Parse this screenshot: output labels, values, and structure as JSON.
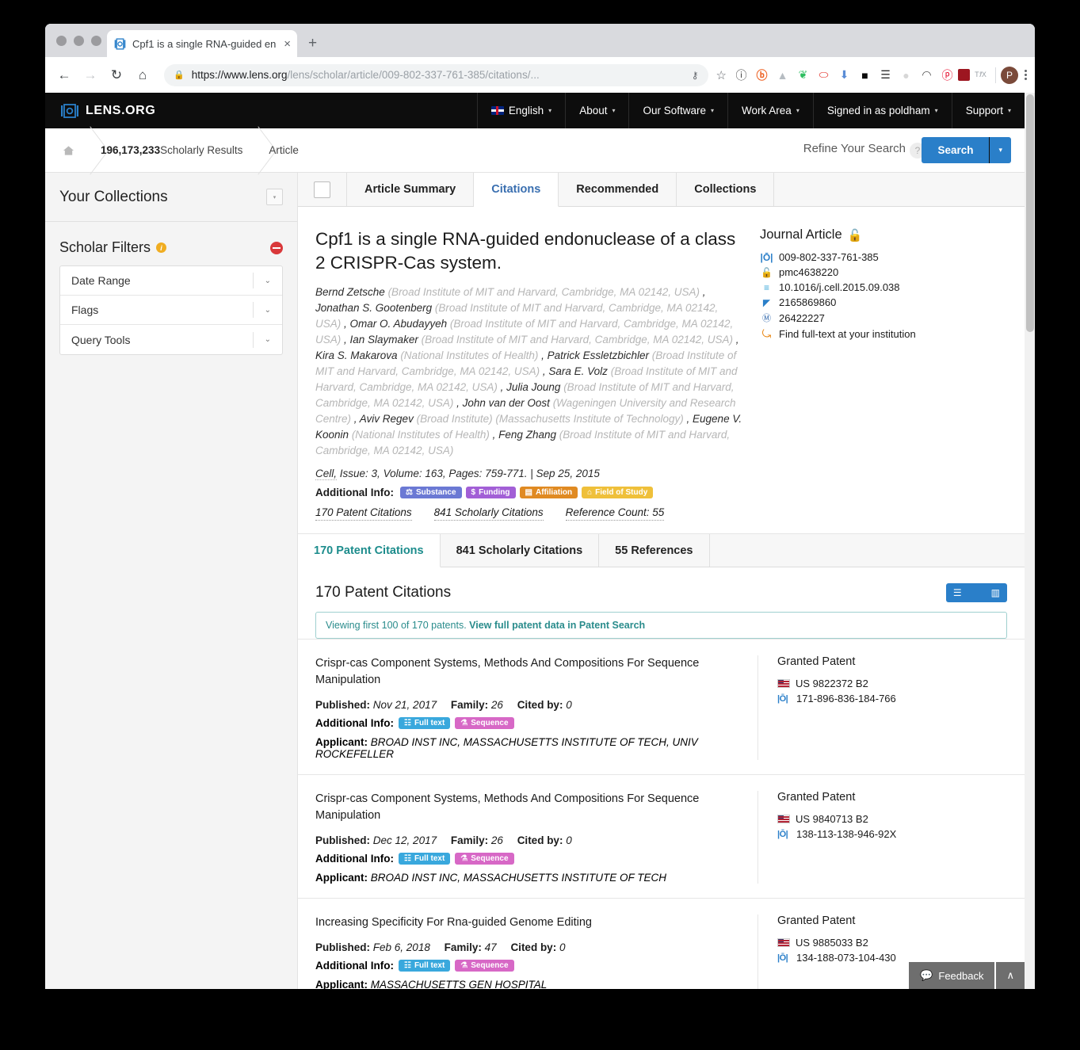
{
  "browser": {
    "tab": {
      "title": "Cpf1 is a single RNA-guided en",
      "favicon": "lens-icon",
      "close": "×"
    },
    "new_tab": "+",
    "nav": {
      "back": "←",
      "forward": "→",
      "reload": "↻",
      "home": "⌂"
    },
    "omnibox": {
      "lock": "🔒",
      "url_bold": "https://www.lens.org",
      "url_rest": "/lens/scholar/article/009-802-337-761-385/citations/...",
      "key_icon": "⚷",
      "star_icon": "☆"
    },
    "extensions": [
      {
        "name": "info-circle-icon",
        "glyph": "ⓘ",
        "color": "#444"
      },
      {
        "name": "bitly-icon",
        "glyph": "ⓑ",
        "color": "#ee6123"
      },
      {
        "name": "google-drive-icon",
        "glyph": "▲",
        "color": "#b6bcc2"
      },
      {
        "name": "evernote-icon",
        "glyph": "❦",
        "color": "#2dbe60"
      },
      {
        "name": "opera-icon",
        "glyph": "⬭",
        "color": "#e2231a"
      },
      {
        "name": "pocket-icon",
        "glyph": "⬇",
        "color": "#5b8dd6"
      },
      {
        "name": "adblock-icon",
        "glyph": "■",
        "color": "#0a0a0a"
      },
      {
        "name": "buffer-icon",
        "glyph": "☰",
        "color": "#2c2c2c"
      },
      {
        "name": "ghost-icon",
        "glyph": "●",
        "color": "#d7d7d7"
      },
      {
        "name": "arc-icon",
        "glyph": "◠",
        "color": "#4a4a4a"
      },
      {
        "name": "pinterest-icon",
        "glyph": "ⓟ",
        "color": "#e60023"
      },
      {
        "name": "mendeley-icon",
        "glyph": "☰",
        "color": "#9d1620"
      },
      {
        "name": "tex-icon",
        "glyph": "ᴛɆx",
        "color": "#9aa0a6"
      }
    ],
    "profile_initial": "P",
    "menu_icon": "kebab-menu-icon"
  },
  "site_header": {
    "logo_mark": "|Ō|",
    "logo_text": "LENS.ORG",
    "nav": [
      {
        "label": "English",
        "has_flag": true
      },
      {
        "label": "About",
        "has_flag": false
      },
      {
        "label": "Our Software",
        "has_flag": false
      },
      {
        "label": "Work Area",
        "has_flag": false
      },
      {
        "label": "Signed in as poldham",
        "has_flag": false,
        "bold_part": "poldham"
      },
      {
        "label": "Support",
        "has_flag": false
      }
    ],
    "caret": "▾"
  },
  "breadcrumb": {
    "home_icon": "🏠",
    "results_count": "196,173,233",
    "results_label": " Scholarly Results",
    "current": "Article",
    "refine_label": "Refine Your Search",
    "help": "?",
    "search_button": "Search",
    "search_caret": "▾"
  },
  "sidebar": {
    "collections_title": "Your Collections",
    "collections_caret": "▾",
    "filters_title": "Scholar Filters",
    "filters_info": "i",
    "facets": [
      {
        "label": "Date Range",
        "chevron": "⌄"
      },
      {
        "label": "Flags",
        "chevron": "⌄"
      },
      {
        "label": "Query Tools",
        "chevron": "⌄"
      }
    ]
  },
  "main_tabs": [
    {
      "label": "Article Summary",
      "active": false
    },
    {
      "label": "Citations",
      "active": true
    },
    {
      "label": "Recommended",
      "active": false
    },
    {
      "label": "Collections",
      "active": false
    }
  ],
  "article": {
    "title": "Cpf1 is a single RNA-guided endonuclease of a class 2 CRISPR-Cas system.",
    "authors": [
      {
        "name": "Bernd Zetsche",
        "affiliation": "(Broad Institute of MIT and Harvard, Cambridge, MA 02142, USA)"
      },
      {
        "name": "Jonathan S. Gootenberg",
        "affiliation": "(Broad Institute of MIT and Harvard, Cambridge, MA 02142, USA)"
      },
      {
        "name": "Omar O. Abudayyeh",
        "affiliation": "(Broad Institute of MIT and Harvard, Cambridge, MA 02142, USA)"
      },
      {
        "name": "Ian Slaymaker",
        "affiliation": "(Broad Institute of MIT and Harvard, Cambridge, MA 02142, USA)"
      },
      {
        "name": "Kira S. Makarova",
        "affiliation": "(National Institutes of Health)"
      },
      {
        "name": "Patrick Essletzbichler",
        "affiliation": "(Broad Institute of MIT and Harvard, Cambridge, MA 02142, USA)"
      },
      {
        "name": "Sara E. Volz",
        "affiliation": "(Broad Institute of MIT and Harvard, Cambridge, MA 02142, USA)"
      },
      {
        "name": "Julia Joung",
        "affiliation": "(Broad Institute of MIT and Harvard, Cambridge, MA 02142, USA)"
      },
      {
        "name": "John van der Oost",
        "affiliation": "(Wageningen University and Research Centre)"
      },
      {
        "name": "Aviv Regev",
        "affiliation": "(Broad Institute) (Massachusetts Institute of Technology)"
      },
      {
        "name": "Eugene V. Koonin",
        "affiliation": "(National Institutes of Health)"
      },
      {
        "name": "Feng Zhang",
        "affiliation": "(Broad Institute of MIT and Harvard, Cambridge, MA 02142, USA)"
      }
    ],
    "journal": "Cell,",
    "issue": "Issue: 3,",
    "volume": "Volume: 163,",
    "pages": "Pages: 759-771.",
    "date_sep": "|",
    "date": "Sep 25, 2015",
    "additional_info_label": "Additional Info:",
    "chips": [
      {
        "label": "Substance",
        "icon": "⚖",
        "color": "#6b79d4"
      },
      {
        "label": "Funding",
        "icon": "$",
        "color": "#a25fd6"
      },
      {
        "label": "Affiliation",
        "icon": "▤",
        "color": "#e08a22"
      },
      {
        "label": "Field of Study",
        "icon": "⌂",
        "color": "#efc03a"
      }
    ],
    "links": [
      "170 Patent Citations",
      "841 Scholarly Citations",
      "Reference Count: 55"
    ],
    "side": {
      "kind": "Journal Article",
      "open_access_icon": "🔓",
      "ids": [
        {
          "icon": "lens-id-icon",
          "glyph": "|Ō|",
          "color": "#2a7fc9",
          "value": "009-802-337-761-385"
        },
        {
          "icon": "open-access-icon",
          "glyph": "🔓",
          "color": "#e8830c",
          "value": "pmc4638220"
        },
        {
          "icon": "crossref-icon",
          "glyph": "≡",
          "color": "#3aa7d8",
          "value": "10.1016/j.cell.2015.09.038"
        },
        {
          "icon": "microsoft-academic-icon",
          "glyph": "◤",
          "color": "#2a7fc9",
          "value": "2165869860"
        },
        {
          "icon": "pubmed-icon",
          "glyph": "Ⓜ",
          "color": "#3a6fb0",
          "value": "26422227"
        },
        {
          "icon": "find-fulltext-icon",
          "glyph": "↺",
          "color": "#e8830c",
          "value": "Find full-text at your institution"
        }
      ]
    }
  },
  "citation_tabs": [
    {
      "label": "170 Patent Citations",
      "active": true
    },
    {
      "label": "841 Scholarly Citations",
      "active": false
    },
    {
      "label": "55 References",
      "active": false
    }
  ],
  "results": {
    "heading": "170 Patent Citations",
    "view_list_icon": "☰",
    "view_chart_icon": "▥",
    "notice_plain": "Viewing first 100 of 170 patents. ",
    "notice_link": "View full patent data in Patent Search",
    "labels": {
      "published": "Published:",
      "family": "Family:",
      "cited_by": "Cited by:",
      "additional_info": "Additional Info:",
      "applicant": "Applicant:"
    },
    "patents": [
      {
        "title": "Crispr-cas Component Systems, Methods And Compositions For Sequence Manipulation",
        "published": "Nov 21, 2017",
        "family": "26",
        "cited_by": "0",
        "chips": [
          {
            "label": "Full text",
            "icon": "☷",
            "color": "#39a8dd"
          },
          {
            "label": "Sequence",
            "icon": "⚗",
            "color": "#d768c6"
          }
        ],
        "applicant": "BROAD INST INC, MASSACHUSETTS INSTITUTE OF TECH, UNIV ROCKEFELLER",
        "kind": "Granted Patent",
        "patent_number": "US 9822372 B2",
        "lens_id": "171-896-836-184-766"
      },
      {
        "title": "Crispr-cas Component Systems, Methods And Compositions For Sequence Manipulation",
        "published": "Dec 12, 2017",
        "family": "26",
        "cited_by": "0",
        "chips": [
          {
            "label": "Full text",
            "icon": "☷",
            "color": "#39a8dd"
          },
          {
            "label": "Sequence",
            "icon": "⚗",
            "color": "#d768c6"
          }
        ],
        "applicant": "BROAD INST INC, MASSACHUSETTS INSTITUTE OF TECH",
        "kind": "Granted Patent",
        "patent_number": "US 9840713 B2",
        "lens_id": "138-113-138-946-92X"
      },
      {
        "title": "Increasing Specificity For Rna-guided Genome Editing",
        "published": "Feb 6, 2018",
        "family": "47",
        "cited_by": "0",
        "chips": [
          {
            "label": "Full text",
            "icon": "☷",
            "color": "#39a8dd"
          },
          {
            "label": "Sequence",
            "icon": "⚗",
            "color": "#d768c6"
          }
        ],
        "applicant": "MASSACHUSETTS GEN HOSPITAL",
        "kind": "Granted Patent",
        "patent_number": "US 9885033 B2",
        "lens_id": "134-188-073-104-430"
      }
    ]
  },
  "feedback": {
    "label": "Feedback",
    "icon": "💬",
    "scroll_top": "∧"
  },
  "colors": {
    "accent_blue": "#2a7fc9",
    "teal": "#1c8c8c",
    "header_black": "#0d0d0d"
  }
}
